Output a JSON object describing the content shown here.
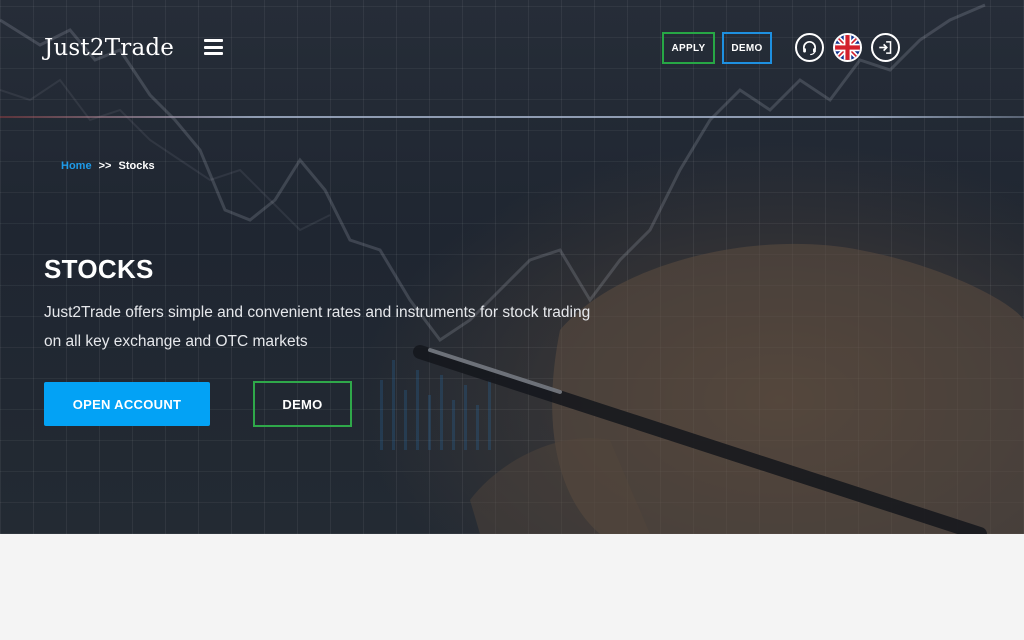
{
  "brand": {
    "name": "Just2Trade"
  },
  "header": {
    "apply_label": "APPLY",
    "demo_label": "DEMO",
    "icons": [
      "menu-icon",
      "headset-icon",
      "uk-flag-icon",
      "login-icon"
    ],
    "colors": {
      "apply_border": "#27a745",
      "demo_border": "#1e90e0"
    }
  },
  "breadcrumb": {
    "home": "Home",
    "separator": ">>",
    "current": "Stocks"
  },
  "hero": {
    "title": "STOCKS",
    "subtitle_line1": "Just2Trade offers simple and  convenient rates and instruments for stock trading",
    "subtitle_line2": "on all key exchange and OTC markets",
    "open_account_label": "OPEN ACCOUNT",
    "demo_label": "DEMO",
    "colors": {
      "primary": "#03a2f5",
      "demo_border": "#2fa84a",
      "breadcrumb_link": "#1e9be9"
    }
  }
}
